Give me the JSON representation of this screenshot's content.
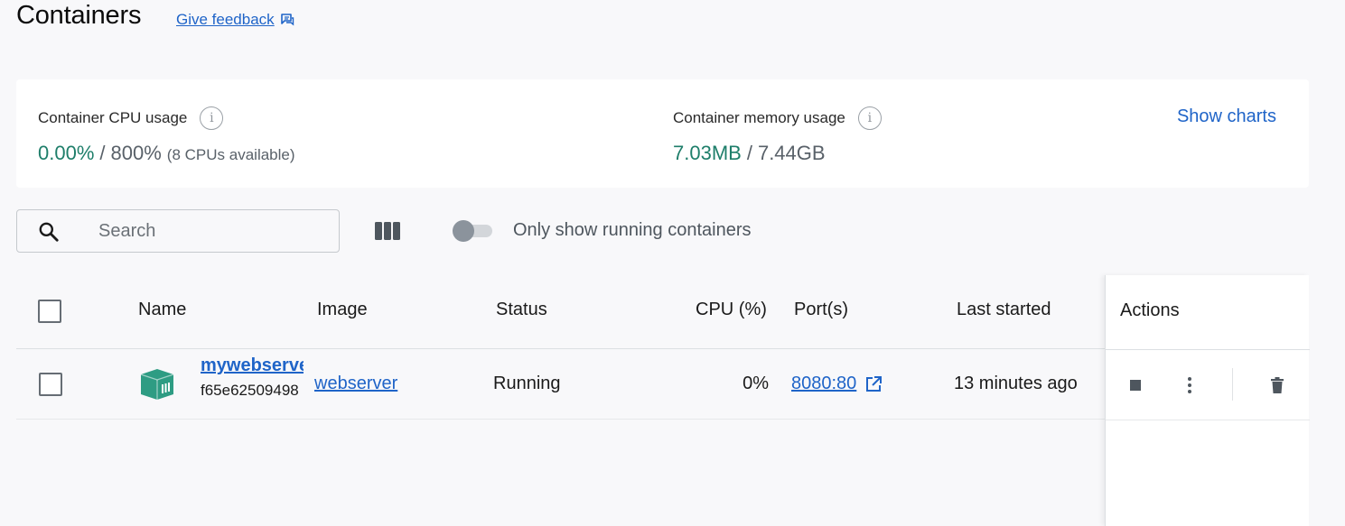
{
  "header": {
    "title": "Containers",
    "feedback_label": "Give feedback"
  },
  "usage": {
    "cpu_label": "Container CPU usage",
    "cpu_used": "0.00%",
    "cpu_separator": "/",
    "cpu_total": "800%",
    "cpu_note": "(8 CPUs available)",
    "memory_label": "Container memory usage",
    "memory_used": "7.03MB",
    "memory_separator": "/",
    "memory_total": "7.44GB",
    "show_charts_label": "Show charts",
    "info_glyph": "i"
  },
  "toolbar": {
    "search_placeholder": "Search",
    "toggle_label": "Only show running containers",
    "toggle_on": false
  },
  "table": {
    "columns": [
      "Name",
      "Image",
      "Status",
      "CPU (%)",
      "Port(s)",
      "Last started",
      "Actions"
    ],
    "rows": [
      {
        "name": "mywebserver",
        "id": "f65e62509498",
        "image": "webserver",
        "status": "Running",
        "cpu": "0%",
        "ports": "8080:80",
        "last_started": "13 minutes ago"
      }
    ]
  },
  "colors": {
    "accent": "#1f64c8",
    "usage_green": "#1e7e6a",
    "container_icon": "#2e9c83"
  },
  "icons": [
    "feedback-icon",
    "info-icon",
    "search-icon",
    "columns-icon",
    "container-icon",
    "external-link-icon",
    "stop-icon",
    "more-vert-icon",
    "trash-icon"
  ]
}
